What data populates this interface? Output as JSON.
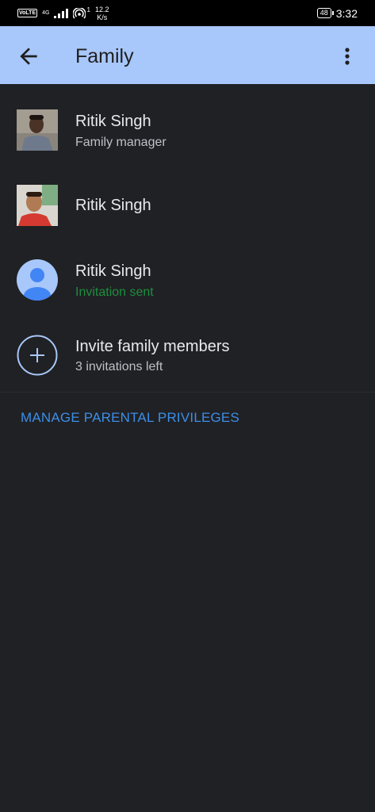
{
  "status_bar": {
    "volte": "VoLTE",
    "network": "4G",
    "hotspot": "1",
    "speed_value": "12.2",
    "speed_unit": "K/s",
    "battery": "48",
    "time": "3:32"
  },
  "app_bar": {
    "title": "Family"
  },
  "members": [
    {
      "name": "Ritik Singh",
      "subtitle": "Family manager"
    },
    {
      "name": "Ritik Singh"
    },
    {
      "name": "Ritik Singh",
      "subtitle": "Invitation sent"
    }
  ],
  "invite": {
    "label": "Invite family members",
    "subtitle": "3 invitations left"
  },
  "manage_link": "MANAGE PARENTAL PRIVILEGES",
  "colors": {
    "app_bar": "#a8c7fa",
    "background": "#202124",
    "link": "#3c8ee8",
    "status_green": "#1e8e3e",
    "avatar_blue": "#a8c7fa",
    "avatar_dark_blue": "#4285f4"
  }
}
